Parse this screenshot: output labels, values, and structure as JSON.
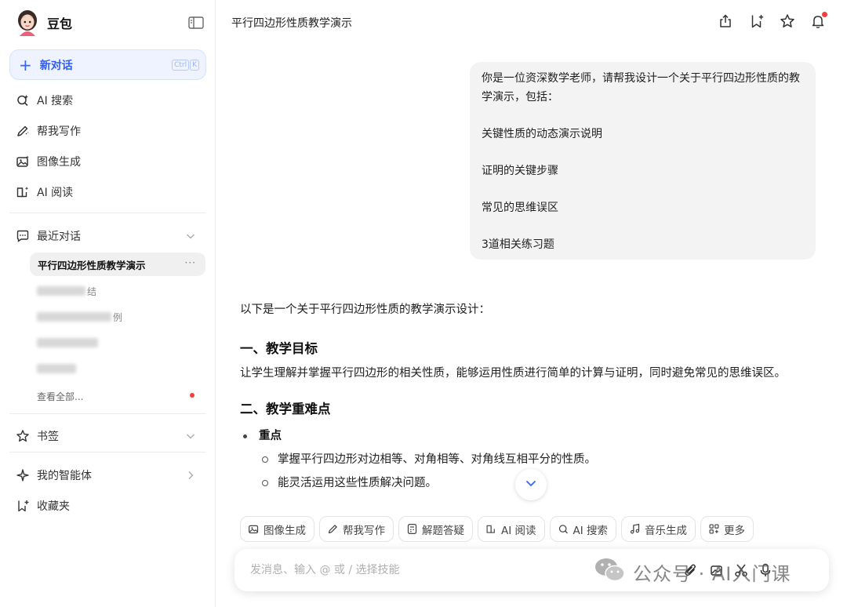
{
  "app": {
    "name": "豆包"
  },
  "sidebar": {
    "new_chat": {
      "label": "新对话",
      "shortcut": [
        "Ctrl",
        "K"
      ]
    },
    "nav": [
      {
        "label": "AI 搜索",
        "icon": "search-sparkle-icon"
      },
      {
        "label": "帮我写作",
        "icon": "pen-icon"
      },
      {
        "label": "图像生成",
        "icon": "image-icon"
      },
      {
        "label": "AI 阅读",
        "icon": "book-icon"
      }
    ],
    "recent": {
      "label": "最近对话",
      "active_item": "平行四边形性质教学演示",
      "blurred_suffixes": [
        "结",
        "例",
        "",
        ""
      ],
      "view_all": "查看全部..."
    },
    "bookmarks": {
      "label": "书签"
    },
    "agents": {
      "label": "我的智能体"
    },
    "favorites": {
      "label": "收藏夹"
    }
  },
  "header": {
    "title": "平行四边形性质教学演示"
  },
  "conversation": {
    "user_message": "你是一位资深数学老师，请帮我设计一个关于平行四边形性质的教学演示，包括：\n\n关键性质的动态演示说明\n\n证明的关键步骤\n\n常见的思维误区\n\n3道相关练习题",
    "answer": {
      "intro": "以下是一个关于平行四边形性质的教学演示设计：",
      "section1_title": "一、教学目标",
      "section1_text": "让学生理解并掌握平行四边形的相关性质，能够运用性质进行简单的计算与证明，同时避免常见的思维误区。",
      "section2_title": "二、教学重难点",
      "bullet1": "重点",
      "sub1": "掌握平行四边形对边相等、对角相等、对角线互相平分的性质。",
      "sub2": "能灵活运用这些性质解决问题。"
    }
  },
  "skills": [
    {
      "label": "图像生成",
      "icon": "image-icon"
    },
    {
      "label": "帮我写作",
      "icon": "pen-icon"
    },
    {
      "label": "解题答疑",
      "icon": "calculator-icon"
    },
    {
      "label": "AI 阅读",
      "icon": "book-icon"
    },
    {
      "label": "AI 搜索",
      "icon": "search-sparkle-icon"
    },
    {
      "label": "音乐生成",
      "icon": "music-icon"
    },
    {
      "label": "更多",
      "icon": "grid-plus-icon"
    }
  ],
  "input": {
    "placeholder": "发消息、输入 @ 或 / 选择技能"
  },
  "watermark": {
    "text": "公众号 · AI入门课"
  }
}
